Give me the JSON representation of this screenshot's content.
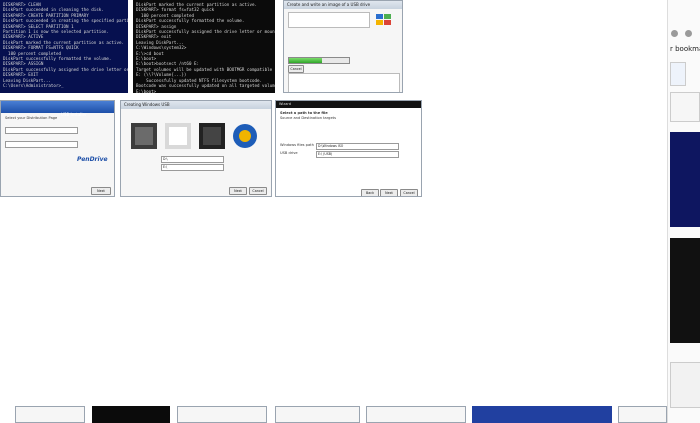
{
  "colors": {
    "cmd_blue": "#06104f",
    "cmd_black": "#0b0b0b",
    "accent_blue": "#1d4fa8",
    "progress_green": "#2fa52a"
  },
  "diskpart_blue": {
    "lines": [
      "DISKPART> CLEAN",
      "DiskPart succeeded in cleaning the disk.",
      "DISKPART> CREATE PARTITION PRIMARY",
      "DiskPart succeeded in creating the specified partition.",
      "DISKPART> SELECT PARTITION 1",
      "Partition 1 is now the selected partition.",
      "DISKPART> ACTIVE",
      "DiskPart marked the current partition as active.",
      "DISKPART> FORMAT FS=NTFS QUICK",
      "  100 percent completed",
      "DiskPart successfully formatted the volume.",
      "DISKPART> ASSIGN",
      "DiskPart successfully assigned the drive letter or mount point.",
      "DISKPART> EXIT",
      "Leaving DiskPart...",
      "C:\\Users\\Administrator>_"
    ]
  },
  "diskpart_black": {
    "lines": [
      "DiskPart marked the current partition as active.",
      "DISKPART> format fs=fat32 quick",
      "  100 percent completed",
      "DiskPart successfully formatted the volume.",
      "DISKPART> assign",
      "DiskPart successfully assigned the drive letter or mount point.",
      "DISKPART> exit",
      "Leaving DiskPart...",
      "C:\\Windows\\system32>",
      "E:\\>cd boot",
      "E:\\boot>",
      "E:\\boot>bootsect /nt60 E:",
      "Target volumes will be updated with BOOTMGR compatible bootcode.",
      "E: (\\\\?\\Volume{...})",
      "    Successfully updated NTFS filesystem bootcode.",
      "Bootcode was successfully updated on all targeted volumes.",
      "E:\\boot>"
    ]
  },
  "usb_tool_window": {
    "title": "Create and write an image of a USB drive",
    "progress_fraction": 0.55,
    "button_label": "Cancel"
  },
  "usb_installer": {
    "title": "USB Installer",
    "heading": "Select your Distribution Page",
    "logo": "PenDrive",
    "button_label": "Next"
  },
  "usb_creation_window": {
    "title": "Creating Windows USB",
    "field1_value": "D:\\",
    "field2_value": "E:\\",
    "button_next": "Next",
    "button_cancel": "Cancel"
  },
  "wizard": {
    "title": "Wizard",
    "heading": "Select a path to the file",
    "subheading": "Source and Destination targets",
    "field_source_label": "Windows files path",
    "field_source_value": "D:\\Windows ISO",
    "field_dest_label": "USB drive",
    "field_dest_value": "E:\\ (USB)",
    "button_back": "Back",
    "button_next": "Next",
    "button_cancel": "Cancel"
  },
  "side_panel": {
    "bookmark_text": "r bookmark"
  }
}
